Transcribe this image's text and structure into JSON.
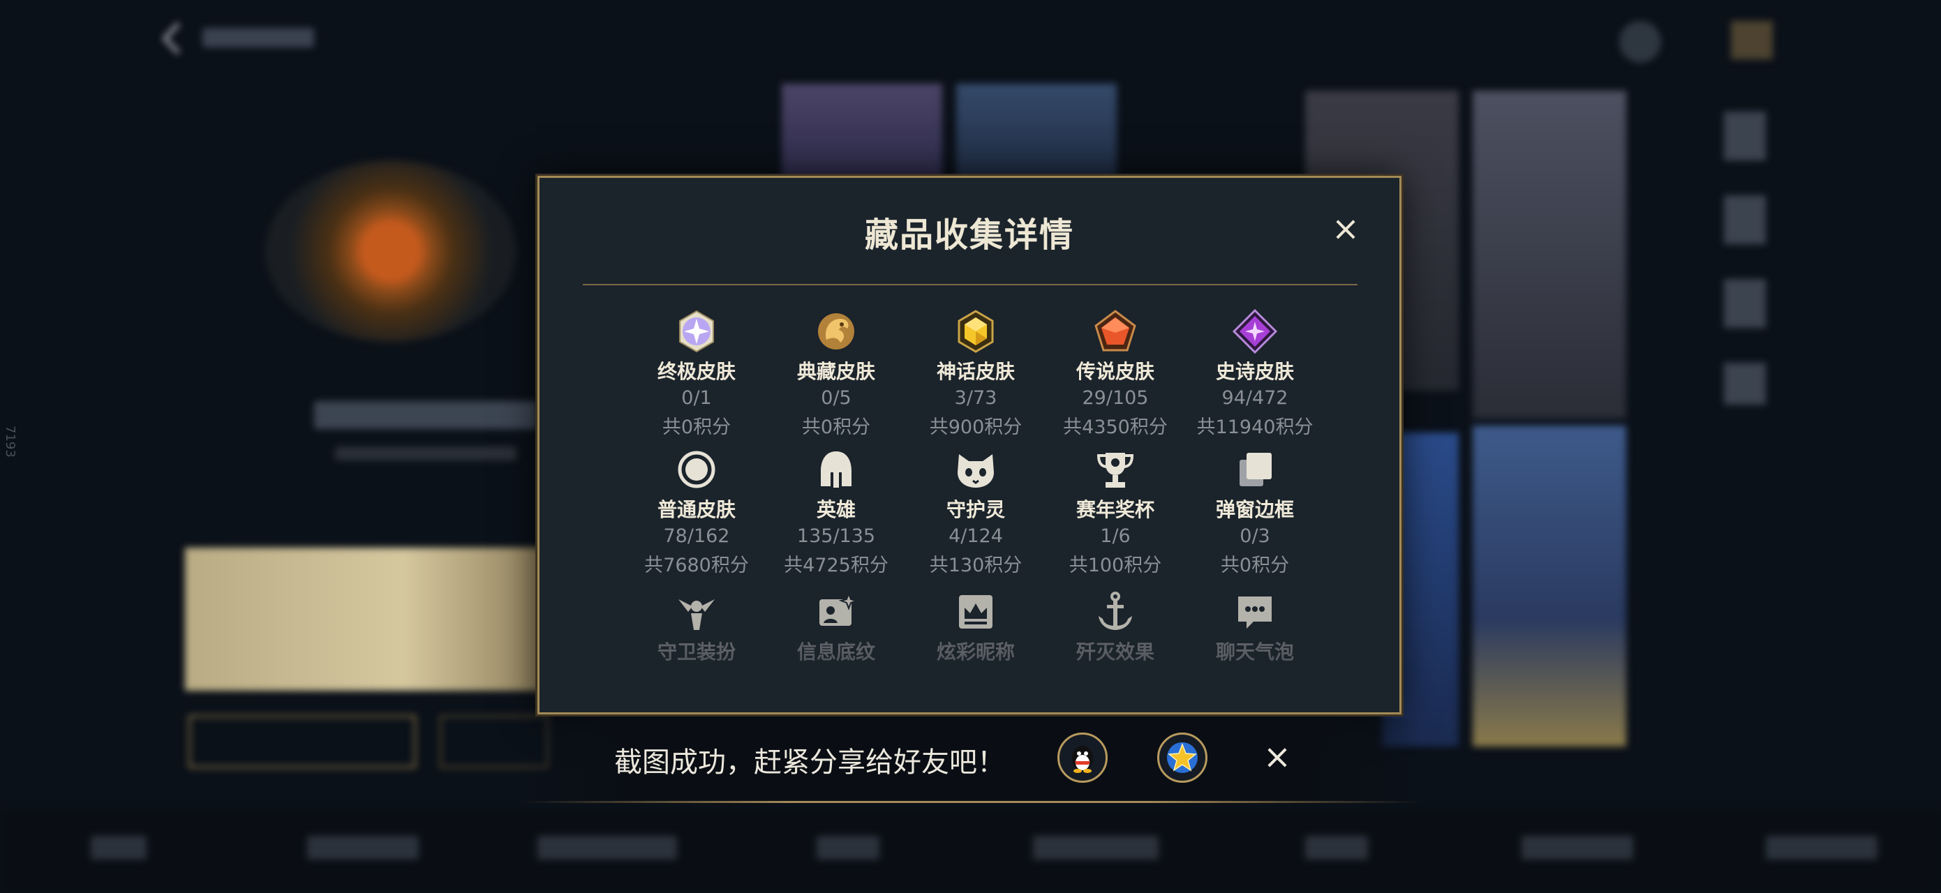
{
  "dialog": {
    "title": "藏品收集详情",
    "close_icon": "×",
    "categories": [
      {
        "name": "终极皮肤",
        "count": "0/1",
        "points": "共0积分",
        "icon": "ultimate-gem-icon"
      },
      {
        "name": "典藏皮肤",
        "count": "0/5",
        "points": "共0积分",
        "icon": "dragon-emblem-icon"
      },
      {
        "name": "神话皮肤",
        "count": "3/73",
        "points": "共900积分",
        "icon": "mythic-gem-icon"
      },
      {
        "name": "传说皮肤",
        "count": "29/105",
        "points": "共4350积分",
        "icon": "legendary-gem-icon"
      },
      {
        "name": "史诗皮肤",
        "count": "94/472",
        "points": "共11940积分",
        "icon": "epic-gem-icon"
      },
      {
        "name": "普通皮肤",
        "count": "78/162",
        "points": "共7680积分",
        "icon": "circle-icon"
      },
      {
        "name": "英雄",
        "count": "135/135",
        "points": "共4725积分",
        "icon": "helmet-icon"
      },
      {
        "name": "守护灵",
        "count": "4/124",
        "points": "共130积分",
        "icon": "guardian-face-icon"
      },
      {
        "name": "赛年奖杯",
        "count": "1/6",
        "points": "共100积分",
        "icon": "trophy-icon"
      },
      {
        "name": "弹窗边框",
        "count": "0/3",
        "points": "共0积分",
        "icon": "frame-stack-icon"
      },
      {
        "name": "守卫装扮",
        "icon": "ward-icon"
      },
      {
        "name": "信息底纹",
        "icon": "info-card-icon"
      },
      {
        "name": "炫彩昵称",
        "icon": "nameplate-icon"
      },
      {
        "name": "歼灭效果",
        "icon": "anchor-icon"
      },
      {
        "name": "聊天气泡",
        "icon": "chat-bubble-icon"
      }
    ]
  },
  "toast": {
    "message": "截图成功，赶紧分享给好友吧！",
    "share_targets": [
      "qq-icon",
      "star-icon"
    ],
    "close_icon": "×"
  },
  "colors": {
    "accent_gold": "#a38a58",
    "dialog_bg": "#1b232b",
    "muted_text": "#8b9097"
  }
}
